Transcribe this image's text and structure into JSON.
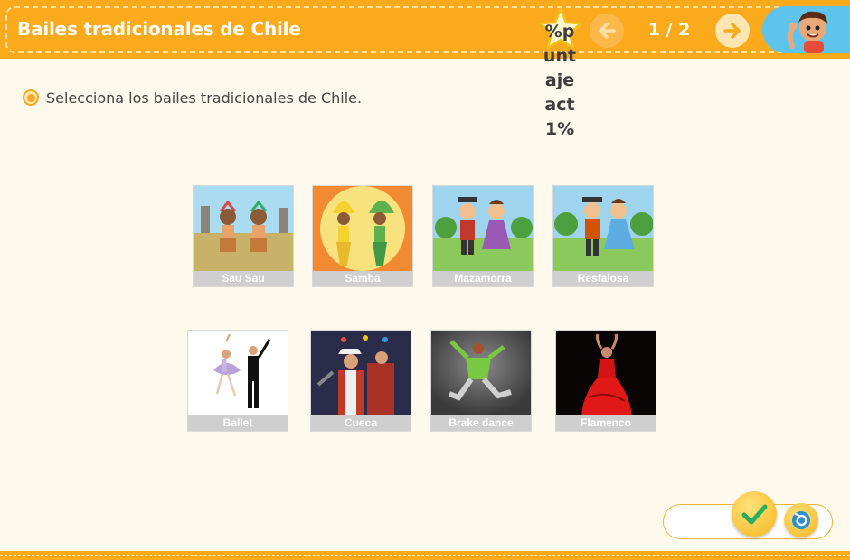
{
  "header": {
    "title": "Bailes tradicionales de Chile",
    "score_lines": [
      "%p",
      "unt",
      "aje",
      "act",
      "1%"
    ],
    "page_indicator": "1 / 2",
    "colors": {
      "bar": "#fbaa1c",
      "avatar_bg": "#5fc4ec"
    }
  },
  "instruction": {
    "text": "Selecciona los bailes tradicionales de Chile."
  },
  "cards": [
    {
      "label": "Sau Sau"
    },
    {
      "label": "Samba"
    },
    {
      "label": "Mazamorra"
    },
    {
      "label": "Resfalosa"
    },
    {
      "label": "Ballet"
    },
    {
      "label": "Cueca"
    },
    {
      "label": "Brake dance"
    },
    {
      "label": "Flamenco"
    }
  ],
  "controls": {
    "check_icon": "check-icon",
    "reset_icon": "reset-icon"
  }
}
